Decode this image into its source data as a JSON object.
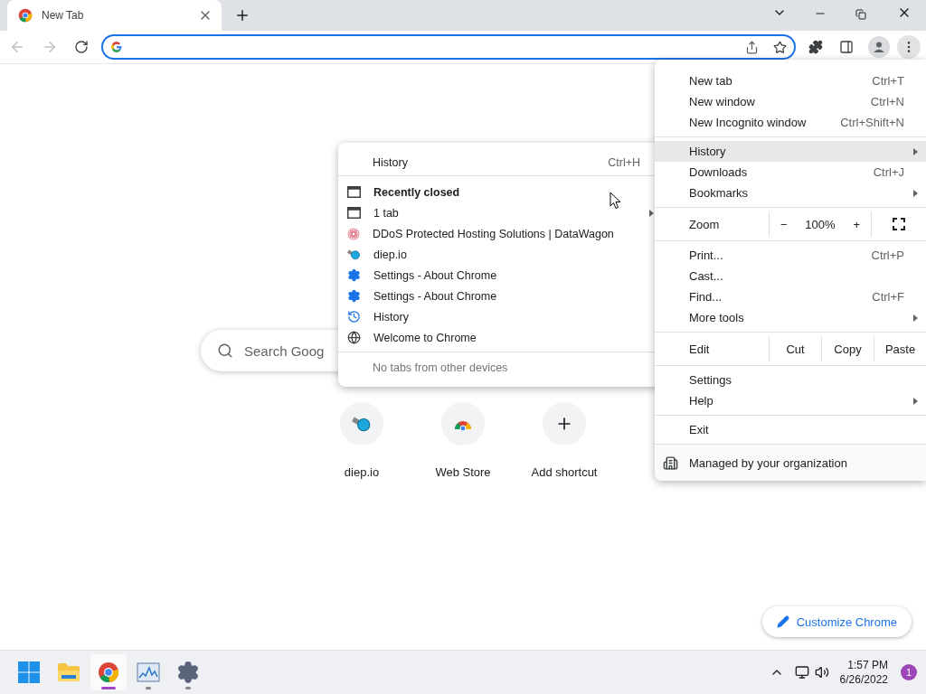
{
  "tabs": [
    {
      "title": "New Tab",
      "selected": true
    }
  ],
  "new_tab_page": {
    "search": {
      "placeholder": "Search Goog"
    },
    "shortcuts": [
      {
        "label": "diep.io",
        "kind": "diep"
      },
      {
        "label": "Web Store",
        "kind": "store"
      },
      {
        "label": "Add shortcut",
        "kind": "add"
      }
    ],
    "customize_button": "Customize Chrome"
  },
  "menu": {
    "sections": [
      {
        "items": [
          {
            "kind": "item",
            "label": "New tab",
            "shortcut": "Ctrl+T",
            "submenu": false,
            "selected": false
          },
          {
            "kind": "item",
            "label": "New window",
            "shortcut": "Ctrl+N",
            "submenu": false,
            "selected": false
          },
          {
            "kind": "item",
            "label": "New Incognito window",
            "shortcut": "Ctrl+Shift+N",
            "submenu": false,
            "selected": false
          }
        ]
      },
      {
        "items": [
          {
            "kind": "item",
            "label": "History",
            "submenu": true,
            "selected": true
          },
          {
            "kind": "item",
            "label": "Downloads",
            "shortcut": "Ctrl+J",
            "submenu": false,
            "selected": false
          },
          {
            "kind": "item",
            "label": "Bookmarks",
            "submenu": true,
            "selected": false
          }
        ]
      },
      {
        "items": [
          {
            "kind": "zoom",
            "label": "Zoom",
            "minus": "−",
            "value": "100%",
            "plus": "+"
          }
        ]
      },
      {
        "items": [
          {
            "kind": "item",
            "label": "Print...",
            "shortcut": "Ctrl+P",
            "submenu": false,
            "selected": false
          },
          {
            "kind": "item",
            "label": "Cast...",
            "submenu": false,
            "selected": false
          },
          {
            "kind": "item",
            "label": "Find...",
            "shortcut": "Ctrl+F",
            "submenu": false,
            "selected": false
          },
          {
            "kind": "item",
            "label": "More tools",
            "submenu": true,
            "selected": false
          }
        ]
      },
      {
        "items": [
          {
            "kind": "edit",
            "label": "Edit",
            "actions": [
              "Cut",
              "Copy",
              "Paste"
            ]
          }
        ]
      },
      {
        "items": [
          {
            "kind": "item",
            "label": "Settings",
            "submenu": false,
            "selected": false
          },
          {
            "kind": "item",
            "label": "Help",
            "submenu": true,
            "selected": false
          }
        ]
      },
      {
        "items": [
          {
            "kind": "item",
            "label": "Exit",
            "submenu": false,
            "selected": false
          }
        ]
      },
      {
        "items": [
          {
            "kind": "managed",
            "label": "Managed by your organization"
          }
        ]
      }
    ]
  },
  "history_submenu": {
    "header": {
      "label": "History",
      "shortcut": "Ctrl+H"
    },
    "items": [
      {
        "kind": "heading",
        "label": "Recently closed",
        "submenu": false
      },
      {
        "kind": "window",
        "label": "1 tab",
        "submenu": true
      },
      {
        "kind": "spiral",
        "label": "DDoS Protected Hosting Solutions | DataWagon",
        "submenu": false
      },
      {
        "kind": "diep",
        "label": "diep.io",
        "submenu": false
      },
      {
        "kind": "settings",
        "label": "Settings - About Chrome",
        "submenu": false
      },
      {
        "kind": "settings",
        "label": "Settings - About Chrome",
        "submenu": false
      },
      {
        "kind": "history",
        "label": "History",
        "submenu": false
      },
      {
        "kind": "globe",
        "label": "Welcome to Chrome",
        "submenu": false
      }
    ],
    "footer": "No tabs from other devices"
  },
  "taskbar": {
    "apps": [
      {
        "kind": "start",
        "active": false,
        "running": false
      },
      {
        "kind": "files",
        "active": false,
        "running": false
      },
      {
        "kind": "chrome",
        "active": true,
        "running": true
      },
      {
        "kind": "monitor",
        "active": false,
        "running": true
      },
      {
        "kind": "settings",
        "active": false,
        "running": true
      }
    ],
    "clock": {
      "time": "1:57 PM",
      "date": "6/26/2022"
    },
    "notifications": "1"
  }
}
